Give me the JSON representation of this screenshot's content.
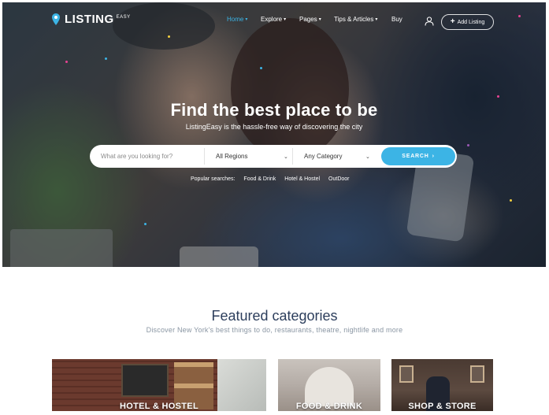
{
  "brand": {
    "name": "LISTING",
    "sup": "EASY",
    "accent": "#3cb4e5"
  },
  "nav": {
    "items": [
      {
        "label": "Home",
        "active": true,
        "caret": true
      },
      {
        "label": "Explore",
        "active": false,
        "caret": true
      },
      {
        "label": "Pages",
        "active": false,
        "caret": true
      },
      {
        "label": "Tips & Articles",
        "active": false,
        "caret": true
      },
      {
        "label": "Buy",
        "active": false,
        "caret": false
      }
    ],
    "user_icon": "user-icon",
    "add_listing_label": "Add Listing"
  },
  "hero": {
    "title": "Find the best place to be",
    "subtitle": "ListingEasy is the hassle-free way of discovering the city"
  },
  "search": {
    "placeholder": "What are you looking for?",
    "region": "All Regions",
    "category": "Any Category",
    "button_label": "SEARCH"
  },
  "popular": {
    "label": "Popular searches:",
    "items": [
      "Food & Drink",
      "Hotel & Hostel",
      "OutDoor"
    ]
  },
  "featured": {
    "title": "Featured categories",
    "subtitle": "Discover New York's best things to do, restaurants, theatre, nightlife and more",
    "cards": [
      {
        "label": "HOTEL & HOSTEL"
      },
      {
        "label": "FOOD & DRINK"
      },
      {
        "label": "SHOP & STORE"
      }
    ]
  }
}
